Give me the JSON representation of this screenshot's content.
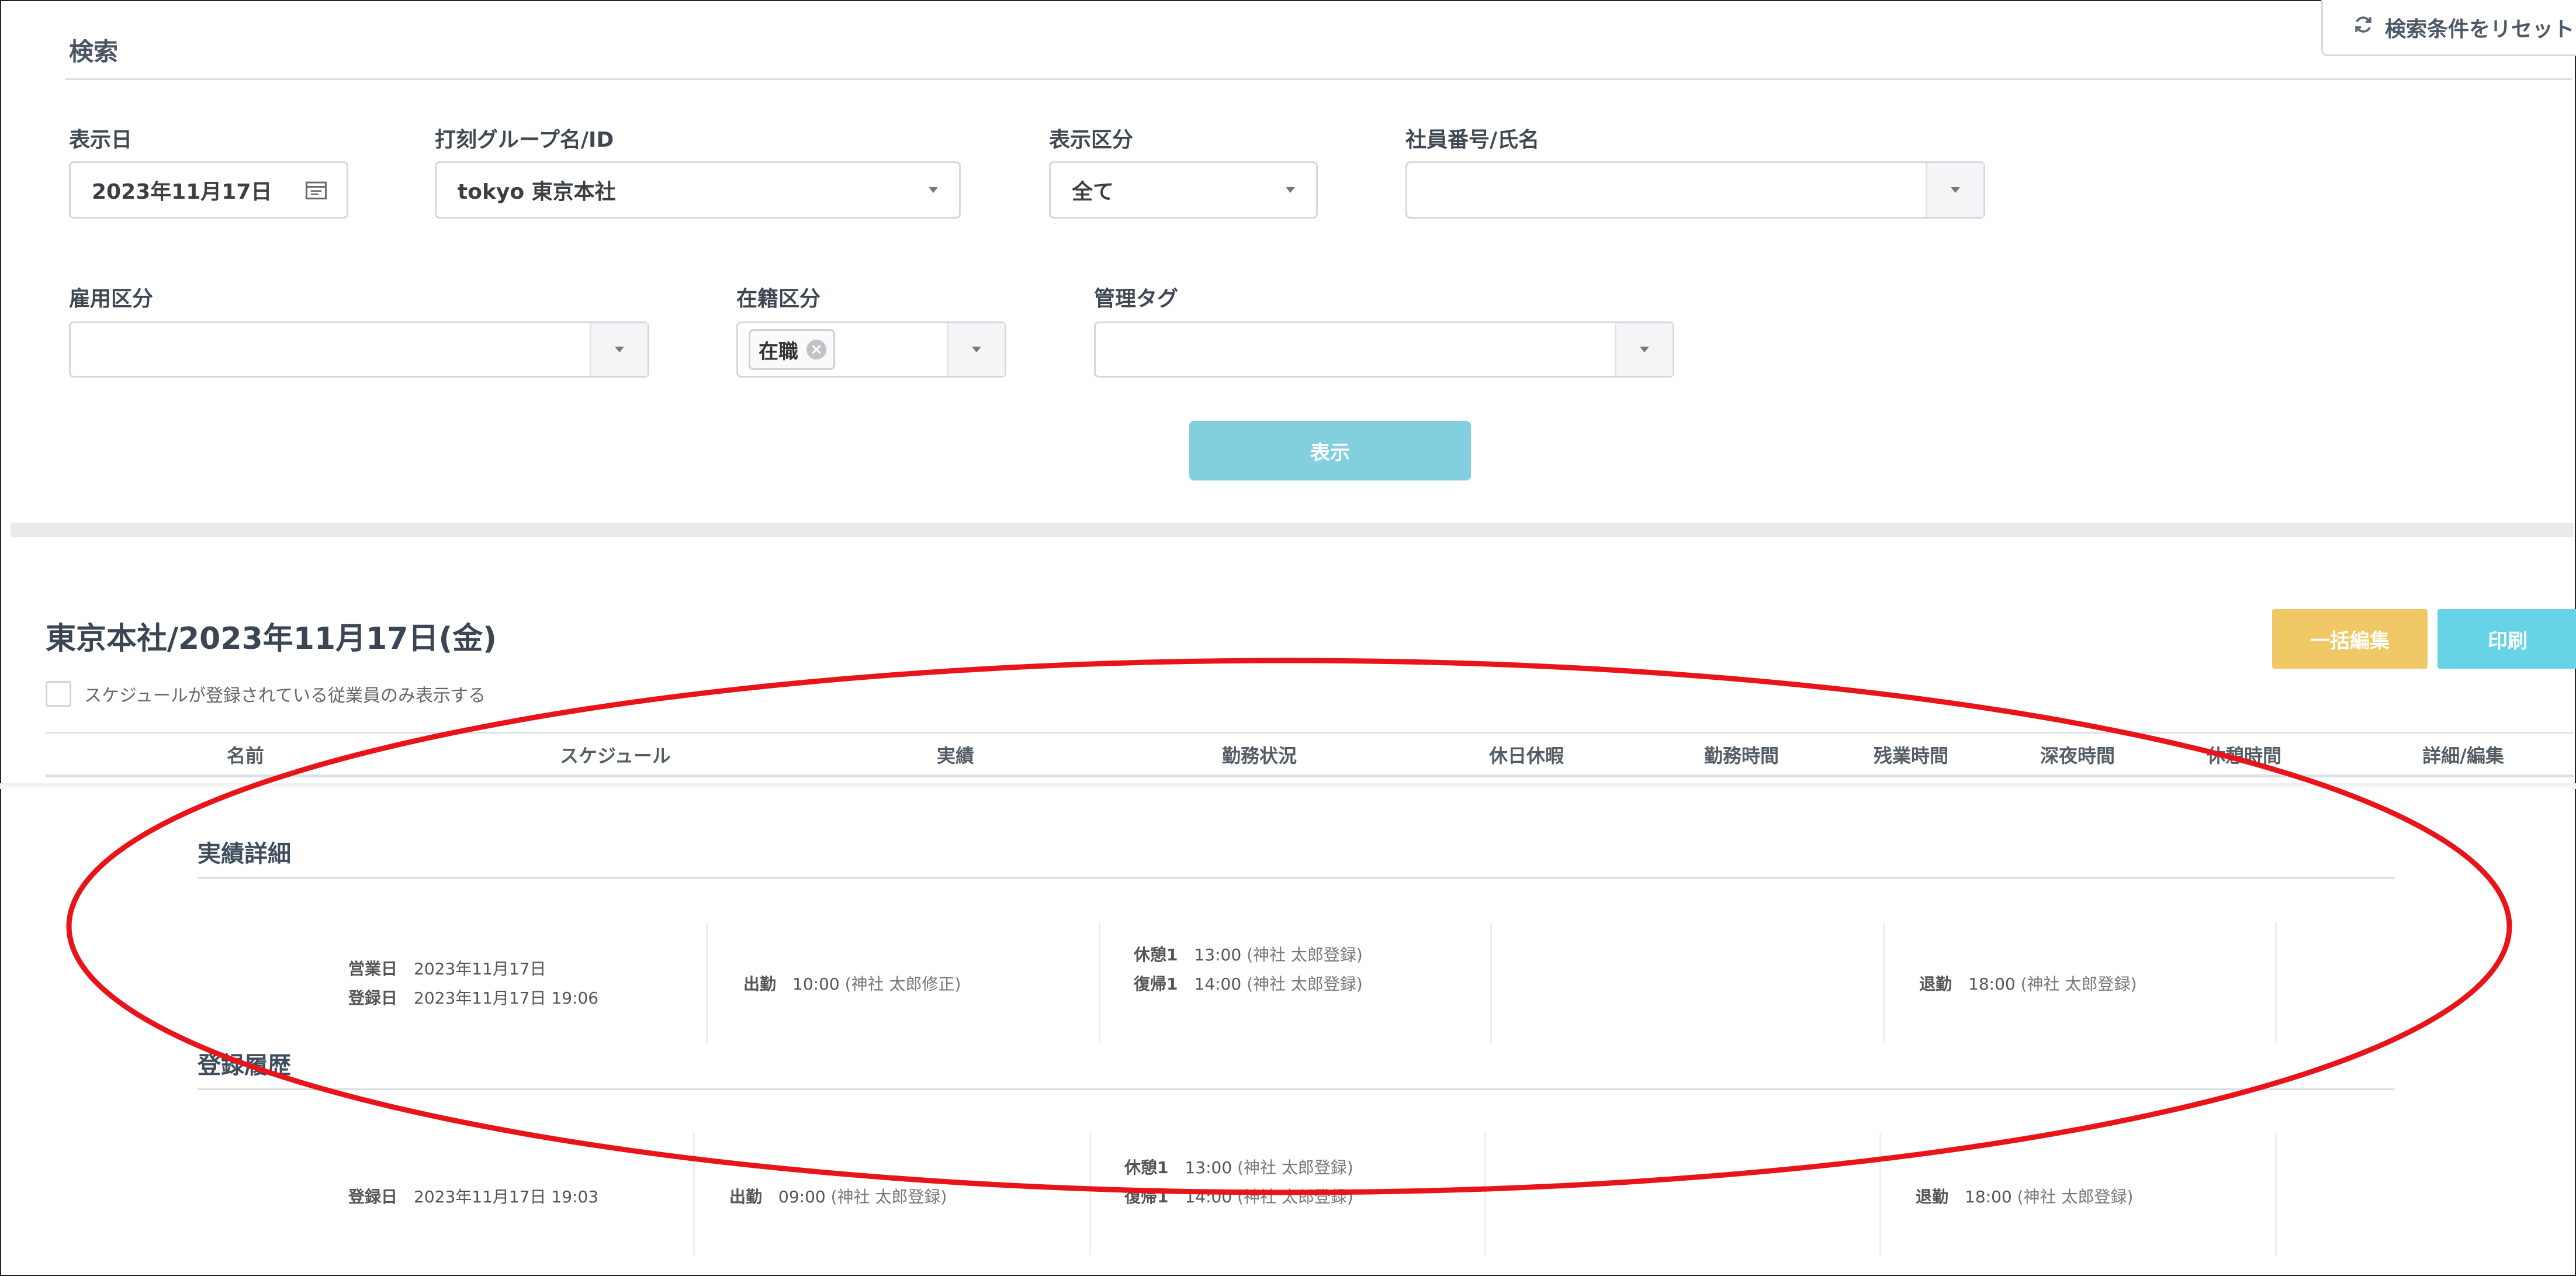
{
  "search_panel": {
    "title": "検索",
    "reset_label": "検索条件をリセット",
    "display_date": {
      "label": "表示日",
      "value": "2023年11月17日"
    },
    "punch_group": {
      "label": "打刻グループ名/ID",
      "value": "tokyo 東京本社"
    },
    "display_type": {
      "label": "表示区分",
      "value": "全て"
    },
    "employee": {
      "label": "社員番号/氏名",
      "value": ""
    },
    "employment_type": {
      "label": "雇用区分",
      "value": ""
    },
    "enrollment": {
      "label": "在籍区分",
      "tag": "在職"
    },
    "mgmt_tag": {
      "label": "管理タグ",
      "value": ""
    },
    "show_label": "表示"
  },
  "results": {
    "title": "東京本社/2023年11月17日(金)",
    "bulk_edit_label": "一括編集",
    "print_label": "印刷",
    "schedule_only_label": "スケジュールが登録されている従業員のみ表示する",
    "columns": [
      "名前",
      "スケジュール",
      "実績",
      "勤務状況",
      "休日休暇",
      "勤務時間",
      "残業時間",
      "深夜時間",
      "休憩時間",
      "詳細/編集"
    ]
  },
  "actual_detail": {
    "title": "実績詳細",
    "business_day_label": "営業日",
    "business_day": "2023年11月17日",
    "registered_label": "登録日",
    "registered": "2023年11月17日 19:06",
    "clock_in": {
      "label": "出勤",
      "time": "10:00",
      "note": "(神社 太郎修正)"
    },
    "break_start": {
      "label": "休憩1",
      "time": "13:00",
      "note": "(神社 太郎登録)"
    },
    "break_end": {
      "label": "復帰1",
      "time": "14:00",
      "note": "(神社 太郎登録)"
    },
    "clock_out": {
      "label": "退勤",
      "time": "18:00",
      "note": "(神社 太郎登録)"
    }
  },
  "history": {
    "title": "登録履歴",
    "registered_label": "登録日",
    "registered": "2023年11月17日 19:03",
    "clock_in": {
      "label": "出勤",
      "time": "09:00",
      "note": "(神社 太郎登録)"
    },
    "break_start": {
      "label": "休憩1",
      "time": "13:00",
      "note": "(神社 太郎登録)"
    },
    "break_end": {
      "label": "復帰1",
      "time": "14:00",
      "note": "(神社 太郎登録)"
    },
    "clock_out": {
      "label": "退勤",
      "time": "18:00",
      "note": "(神社 太郎登録)"
    }
  },
  "colors": {
    "show_button": "#82cfe0",
    "bulk_button": "#f0c866",
    "print_button": "#66d3e6",
    "annotation": "#e8141a"
  },
  "icons": [
    "reset-icon",
    "calendar-icon",
    "chevron-down-icon",
    "remove-tag-icon"
  ]
}
